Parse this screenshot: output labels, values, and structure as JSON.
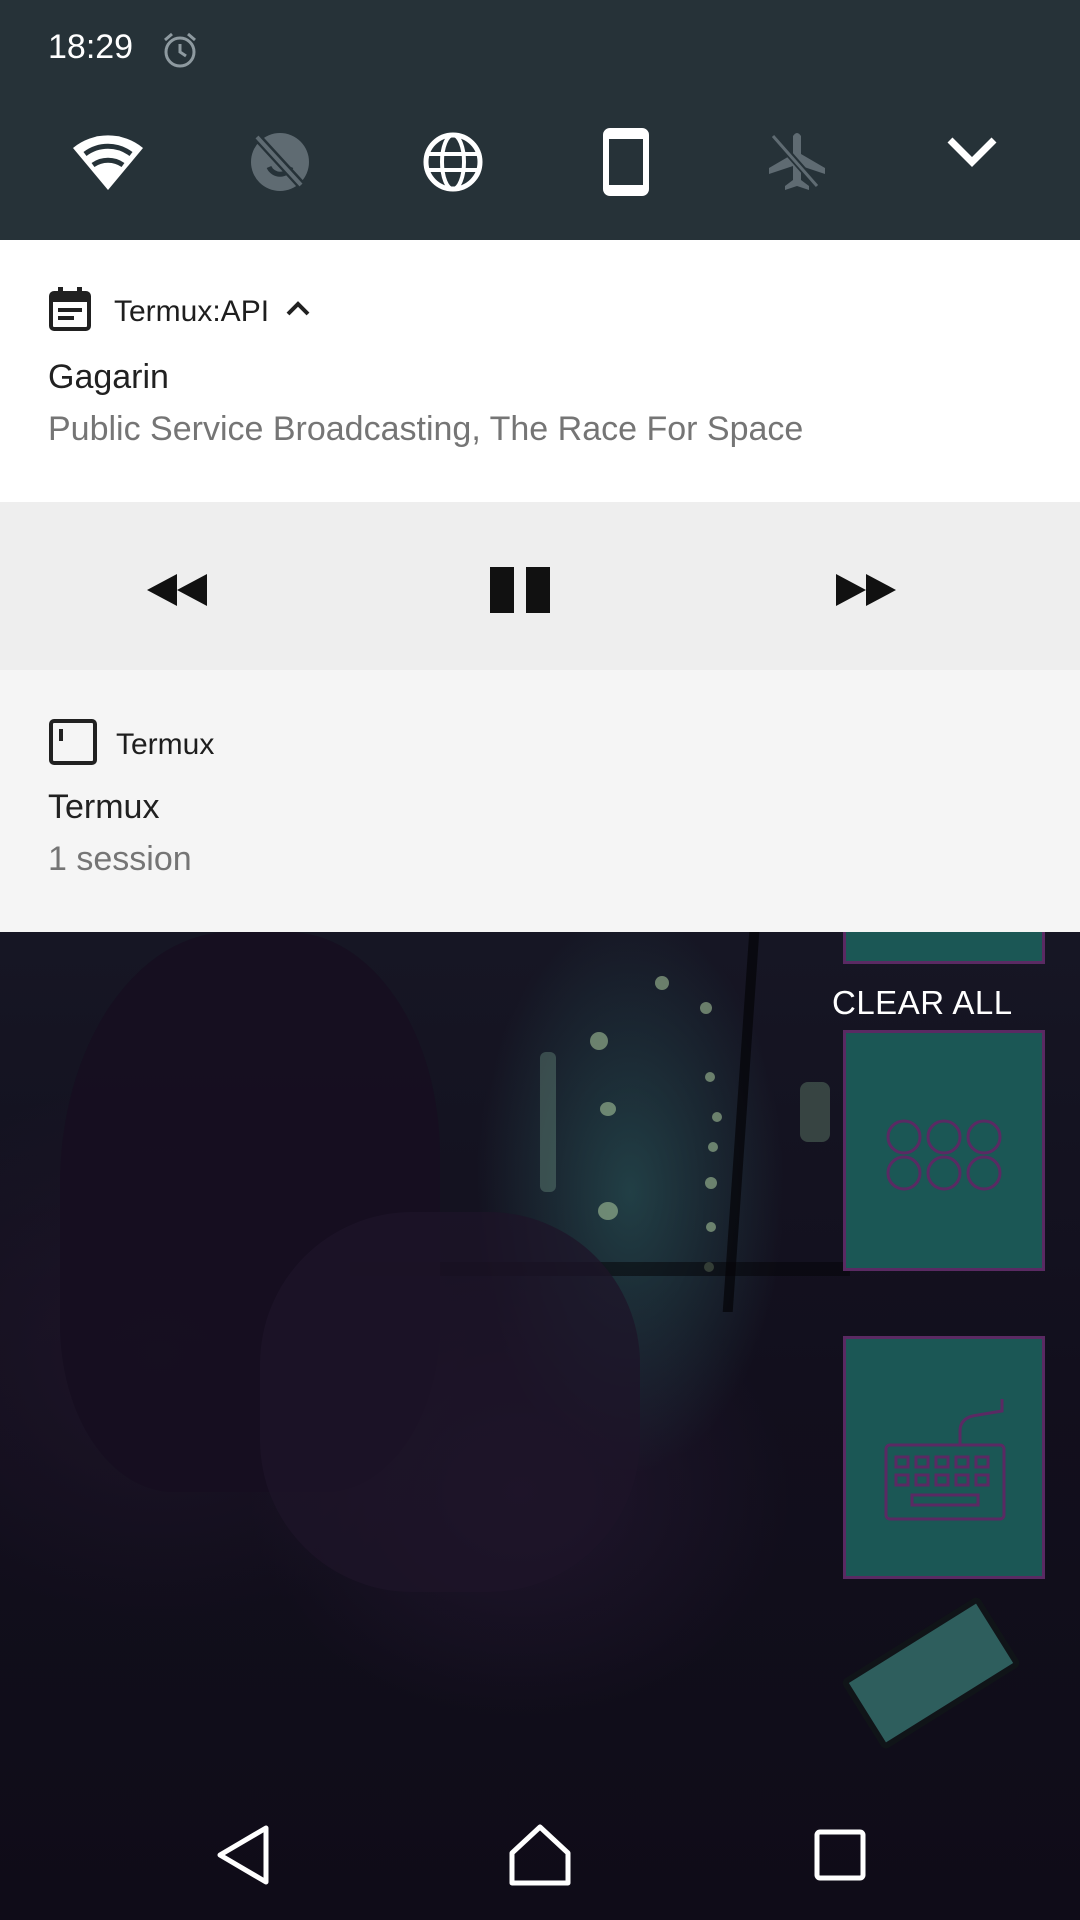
{
  "status": {
    "time": "18:29",
    "alarm_icon": "alarm-icon"
  },
  "quick_settings": [
    {
      "name": "wifi-icon",
      "state": "on"
    },
    {
      "name": "data-saver-off-icon",
      "state": "off"
    },
    {
      "name": "globe-icon",
      "state": "on"
    },
    {
      "name": "phone-rotation-icon",
      "state": "on"
    },
    {
      "name": "airplane-mode-icon",
      "state": "off"
    },
    {
      "name": "chevron-down-icon",
      "state": "expand"
    }
  ],
  "media_notification": {
    "app_name": "Termux:API",
    "title": "Gagarin",
    "subtitle": "Public Service Broadcasting, The Race For Space",
    "controls": [
      "rewind-icon",
      "pause-icon",
      "fast-forward-icon"
    ]
  },
  "termux_notification": {
    "app_name": "Termux",
    "title": "Termux",
    "text": "1 session"
  },
  "clear_all_label": "CLEAR ALL",
  "colors": {
    "header_bg": "#263238",
    "tile_teal": "#1b5755",
    "tile_border": "#5a2a63"
  },
  "nav": [
    "back-icon",
    "home-icon",
    "recents-icon"
  ]
}
